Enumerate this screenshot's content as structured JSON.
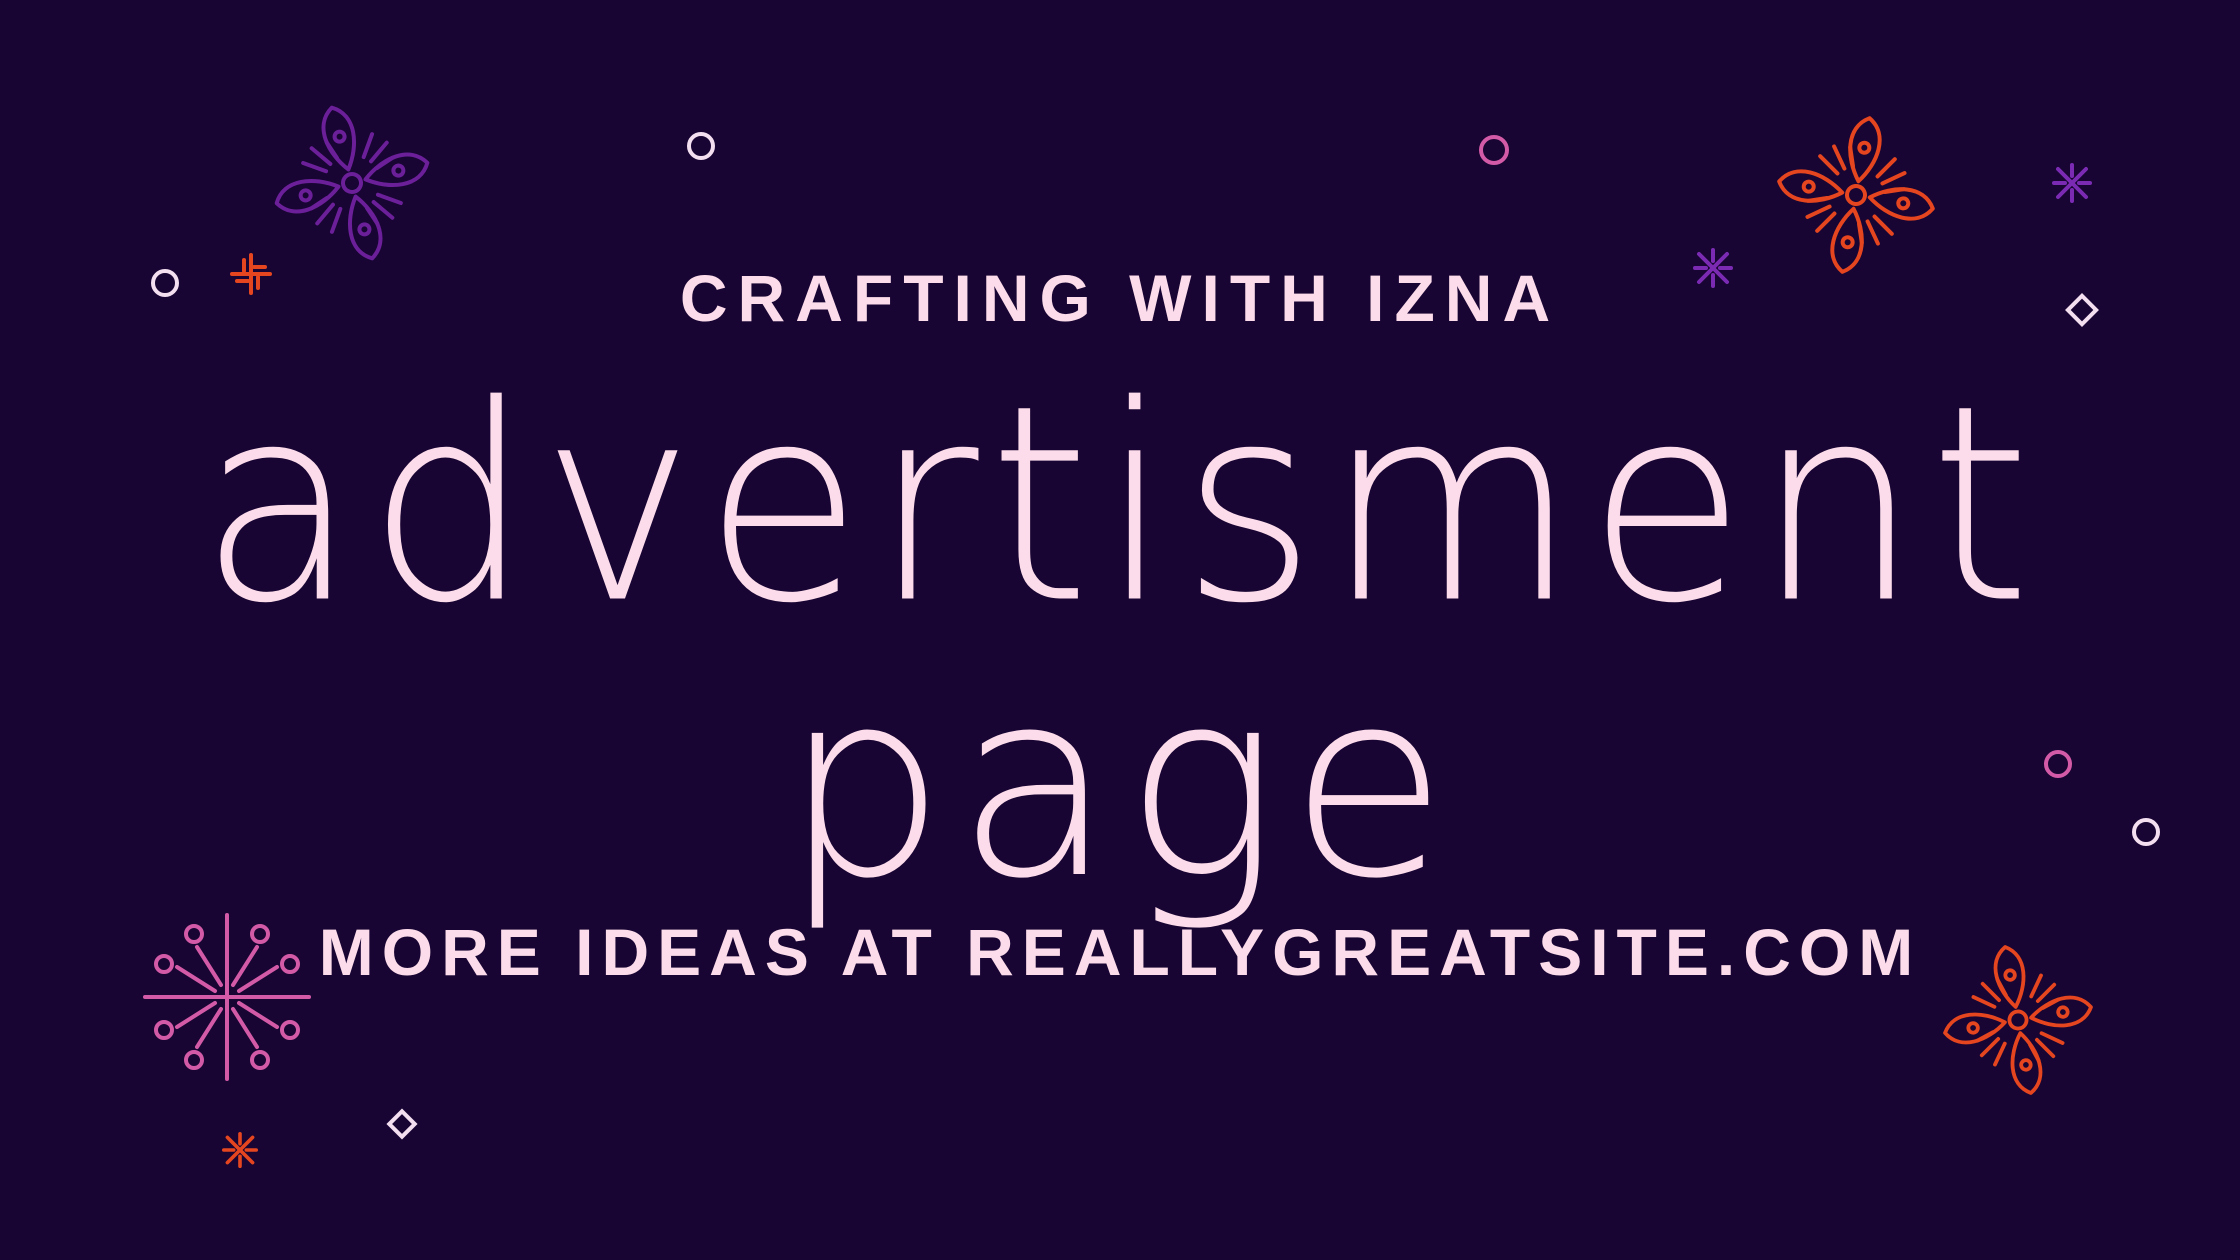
{
  "ad": {
    "eyebrow": "CRAFTING WITH IZNA",
    "headline_line1": "advertisment",
    "headline_line2": "page",
    "footer": "MORE IDEAS AT REALLYGREATSITE.COM"
  },
  "colors": {
    "background": "#180533",
    "text": "#fcdcea",
    "purple": "#6b1f99",
    "orange": "#e5461f",
    "pink": "#d35aa6",
    "violet": "#7b2bb3",
    "light": "#f3dff0"
  },
  "decorations": [
    "flower-icon",
    "sparkle-burst-icon",
    "ring-icon",
    "star-cross-icon",
    "diamond-icon"
  ]
}
